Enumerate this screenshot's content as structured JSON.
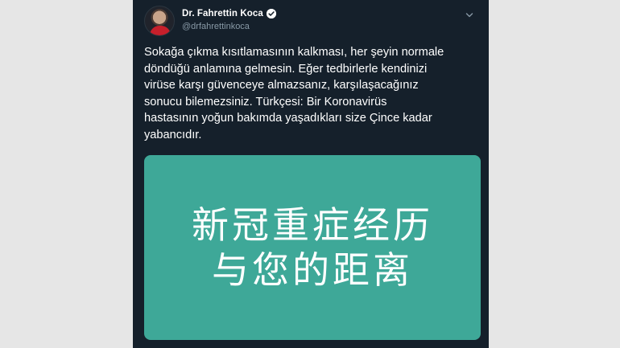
{
  "tweet": {
    "author": {
      "display_name": "Dr. Fahrettin Koca",
      "handle": "@drfahrettinkoca",
      "verified_icon": "verified-badge-icon"
    },
    "menu_icon": "chevron-down-icon",
    "text": "Sokağa çıkma kısıtlamasının kalkması, her şeyin normale\ndöndüğü anlamına gelmesin. Eğer tedbirlerle kendinizi\nvirüse karşı güvenceye almazsanız, karşılaşacağınız\nsonucu bilemezsiniz. Türkçesi: Bir Koronavirüs\nhastasının yoğun bakımda yaşadıkları size Çince kadar\nyabancıdır.",
    "media": {
      "line1": "新冠重症经历",
      "line2": "与您的距离",
      "background": "#3ea898"
    }
  },
  "colors": {
    "card_background": "#15202b",
    "page_background": "#e6e6e6",
    "handle_color": "#8899a6"
  }
}
